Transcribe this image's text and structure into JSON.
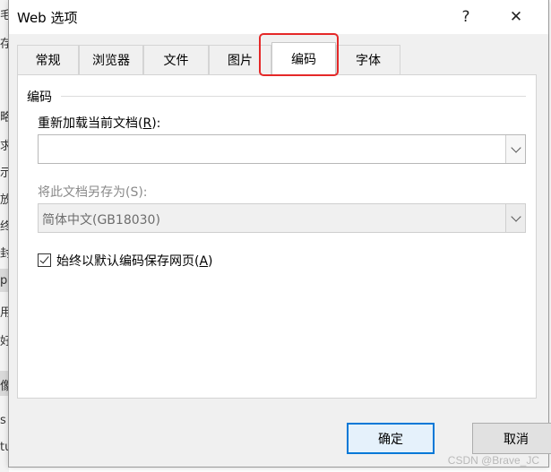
{
  "background": {
    "chars": [
      "毛",
      "存",
      "略",
      "求",
      "示",
      "放",
      "终",
      "封",
      "p",
      "用",
      "好",
      "像",
      "s",
      "tu"
    ]
  },
  "dialog": {
    "title": "Web 选项",
    "help_label": "?",
    "close_label": "✕"
  },
  "tabs": [
    {
      "label": "常规",
      "active": false
    },
    {
      "label": "浏览器",
      "active": false
    },
    {
      "label": "文件",
      "active": false
    },
    {
      "label": "图片",
      "active": false
    },
    {
      "label": "编码",
      "active": true
    },
    {
      "label": "字体",
      "active": false
    }
  ],
  "encoding": {
    "group_label": "编码",
    "reload_label": "重新加载当前文档(",
    "reload_key": "R",
    "reload_suffix": "):",
    "reload_value": "",
    "save_label": "将此文档另存为(S):",
    "save_value": "简体中文(GB18030)",
    "always_label": "始终以默认编码保存网页(",
    "always_key": "A",
    "always_suffix": ")",
    "always_checked": true
  },
  "buttons": {
    "ok": "确定",
    "cancel": "取消"
  },
  "watermark": "CSDN @Brave_JC",
  "colors": {
    "highlight": "#e52828",
    "ok_border": "#0078d7"
  }
}
